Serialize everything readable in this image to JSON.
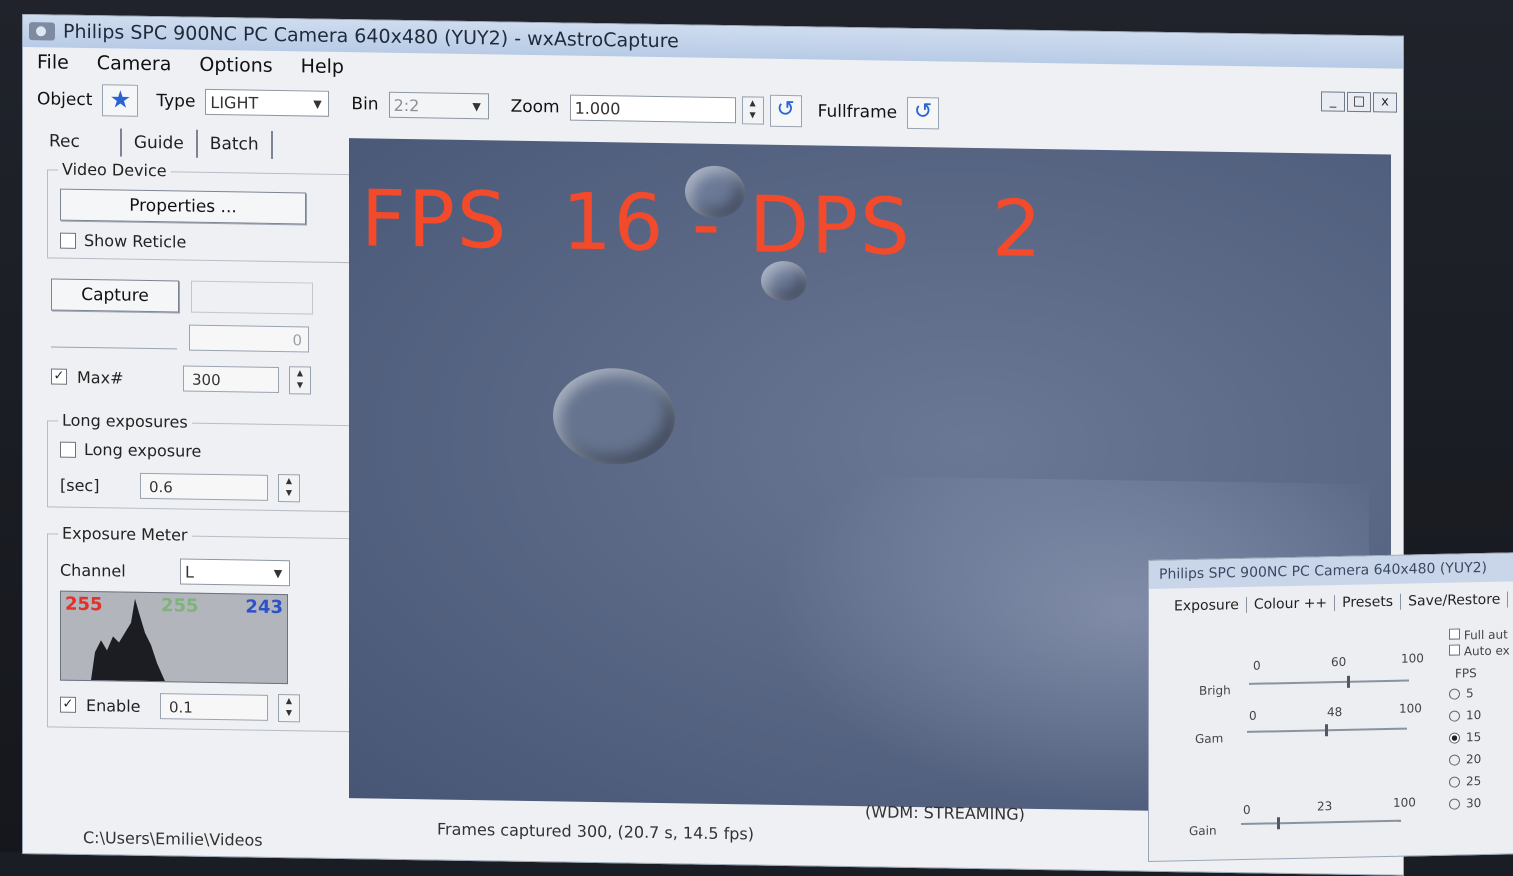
{
  "window": {
    "title": "Philips SPC 900NC PC Camera 640x480 (YUY2) - wxAstroCapture",
    "controls": [
      "_",
      "□",
      "x"
    ]
  },
  "menu": [
    "File",
    "Camera",
    "Options",
    "Help"
  ],
  "toolbar": {
    "object_label": "Object",
    "type_label": "Type",
    "type_value": "LIGHT",
    "bin_label": "Bin",
    "bin_value": "2:2",
    "zoom_label": "Zoom",
    "zoom_value": "1.000",
    "fullframe_label": "Fullframe"
  },
  "tabs": [
    "Rec",
    "Guide",
    "Batch"
  ],
  "video_device": {
    "title": "Video Device",
    "properties_label": "Properties ...",
    "show_reticle_label": "Show Reticle"
  },
  "capture": {
    "button_label": "Capture",
    "counter_value": "0",
    "max_label": "Max#",
    "max_value": "300"
  },
  "long_exposures": {
    "title": "Long exposures",
    "checkbox_label": "Long exposure",
    "sec_label": "[sec]",
    "sec_value": "0.6"
  },
  "exposure_meter": {
    "title": "Exposure Meter",
    "channel_label": "Channel",
    "channel_value": "L",
    "histogram_left": "255",
    "histogram_mid": "255",
    "histogram_right": "243",
    "enable_label": "Enable",
    "enable_value": "0.1"
  },
  "viewport": {
    "overlay_text": "FPS  16 - DPS   2"
  },
  "status": {
    "path": "C:\\Users\\Emilie\\Videos",
    "frames": "Frames captured 300, (20.7 s, 14.5 fps)",
    "wdm": "(WDM: STREAMING)"
  },
  "properties_window": {
    "title": "Philips SPC 900NC PC Camera 640x480 (YUY2)",
    "tabs": [
      "Exposure",
      "Colour ++",
      "Presets",
      "Save/Restore"
    ],
    "sliders": [
      {
        "label": "Brigh",
        "min": "0",
        "value": "60",
        "max": "100"
      },
      {
        "label": "Gam",
        "min": "0",
        "value": "48",
        "max": "100"
      },
      {
        "label": "Gain",
        "min": "0",
        "value": "23",
        "max": "100"
      }
    ],
    "checks": [
      "Full aut",
      "Auto ex"
    ],
    "fps_title": "FPS",
    "fps_options": [
      "5",
      "10",
      "15",
      "20",
      "25",
      "30"
    ],
    "fps_selected": "15"
  }
}
